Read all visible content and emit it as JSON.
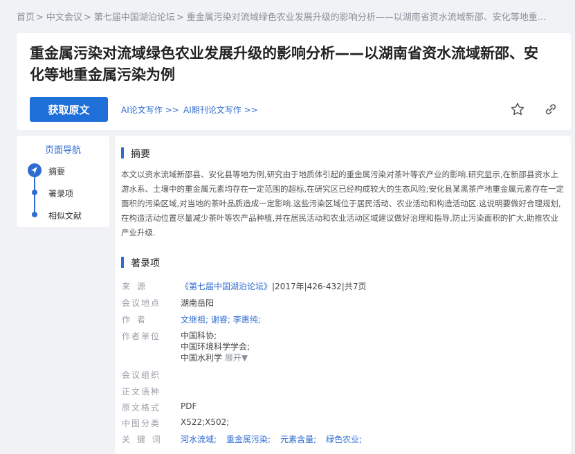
{
  "breadcrumb": [
    {
      "label": "首页",
      "sep": ">"
    },
    {
      "label": "中文会议",
      "sep": ">"
    },
    {
      "label": "第七届中国湖泊论坛",
      "sep": ">"
    },
    {
      "label": "重金属污染对流域绿色农业发展升级的影响分析——以湖南省资水流域新邵、安化等地重...",
      "sep": ""
    }
  ],
  "header": {
    "title": "重金属污染对流域绿色农业发展升级的影响分析——以湖南省资水流域新邵、安化等地重金属污染为例",
    "get_button": "获取原文",
    "ai_link_1": "AI论文写作 >>",
    "ai_link_2": "AI期刊论文写作 >>",
    "favorite_icon": "star-icon",
    "share_icon": "link-icon"
  },
  "nav": {
    "title": "页面导航",
    "items": [
      "摘要",
      "著录项",
      "相似文献"
    ]
  },
  "abstract": {
    "heading": "摘要",
    "text": "本文以资水流域新邵县、安化县等地为例,研究由于地质体引起的重金属污染对茶叶等农产业的影响.研究显示,在新邵县资水上游水系、土壤中的重金属元素均存在一定范围的超标,在研究区已经构成较大的生态风险;安化县某黑茶产地重金属元素存在一定面积的污染区域,对当地的茶叶品质造成一定影响.这些污染区域位于居民活动、农业活动和构造活动区.这说明要做好合理规划,在构造活动位置尽量减少茶叶等农产品种植,并在居民活动和农业活动区域建议做好治理和指导,防止污染面积的扩大,助推农业产业升级."
  },
  "record": {
    "heading": "著录项",
    "source_label": "来 源",
    "source_link": "《第七届中国湖泊论坛》",
    "source_rest": "|2017年|426-432|共7页",
    "location_label": "会议地点",
    "location_value": "湖南岳阳",
    "authors_label": "作 者",
    "authors": [
      "文继祖;",
      "谢睿;",
      "李惠纯;"
    ],
    "units_label": "作者单位",
    "units": [
      "中国科协;",
      "中国环境科学学会;",
      "中国水利学"
    ],
    "expand_label": "展开▼",
    "organizer_label": "会议组织",
    "language_label": "正文语种",
    "format_label": "原文格式",
    "format_value": "PDF",
    "clc_label": "中图分类",
    "clc_value": "X522;X502;",
    "keywords_label": "关 键 词",
    "keywords": [
      "河水流域;",
      "重金属污染;",
      "元素含量;",
      "绿色农业;"
    ]
  },
  "colors": {
    "accent": "#2f6cd1",
    "button": "#1f6fd8",
    "background": "#f1f2f5"
  }
}
